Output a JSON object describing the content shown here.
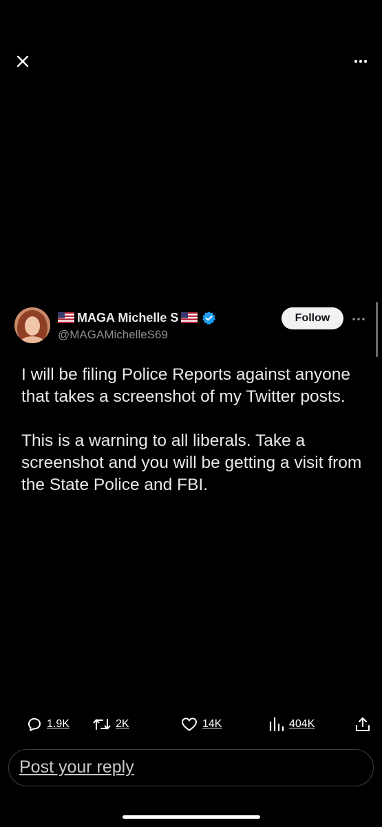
{
  "tweet": {
    "display_name": "MAGA Michelle S",
    "handle": "@MAGAMichelleS69",
    "follow_label": "Follow",
    "paragraphs": [
      "I will be filing Police Reports against anyone that takes a screenshot of my Twitter posts.",
      "This is a warning to all liberals. Take a screenshot and you will be getting a visit from the State Police and FBI."
    ]
  },
  "actions": {
    "replies": "1.9K",
    "reposts": "2K",
    "likes": "14K",
    "views": "404K"
  },
  "reply": {
    "placeholder": "Post your reply"
  },
  "icons": {
    "close": "close-icon",
    "more": "more-horizontal-icon",
    "flag": "us-flag-icon",
    "verified": "verified-badge-icon",
    "reply": "reply-icon",
    "repost": "repost-icon",
    "like": "heart-icon",
    "views": "views-chart-icon",
    "share": "share-icon"
  },
  "colors": {
    "background": "#000000",
    "text": "#e7e9ea",
    "secondary_text": "#8a8d91",
    "verified_blue": "#1d9bf0",
    "follow_bg": "#f2f2f2"
  }
}
